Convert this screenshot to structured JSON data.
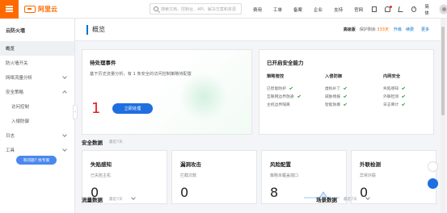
{
  "topbar": {
    "logo_text": "阿里云",
    "search_placeholder": "搜索文档、控制台、API、解决方案和资源",
    "nav": [
      "费用",
      "工单",
      "备案",
      "企业",
      "支持",
      "官网"
    ],
    "lang": "简体"
  },
  "sidebar": {
    "title": "云防火墙",
    "items": [
      {
        "label": "概览",
        "active": true,
        "chevron": false,
        "sub": false
      },
      {
        "label": "防火墙开关",
        "active": false,
        "chevron": false,
        "sub": false
      },
      {
        "label": "网络流量分析",
        "active": false,
        "chevron": true,
        "sub": false
      },
      {
        "label": "安全策略",
        "active": false,
        "chevron": true,
        "sub": false
      },
      {
        "label": "访问控制",
        "active": false,
        "chevron": false,
        "sub": true
      },
      {
        "label": "入侵防御",
        "active": false,
        "chevron": false,
        "sub": true
      },
      {
        "label": "日志",
        "active": false,
        "chevron": true,
        "sub": false
      },
      {
        "label": "工具",
        "active": false,
        "chevron": true,
        "sub": false
      }
    ],
    "help_label": "有问题? 找专家",
    "collapse_glyph": "‹"
  },
  "header": {
    "title": "概览",
    "edition": "高级版",
    "protect_label": "保护剩余",
    "protect_value": "333天",
    "upgrade": "升级",
    "renew": "续费",
    "more": "更多"
  },
  "pending": {
    "title": "待处理事件",
    "desc": "基于历史流量分析，有 1 条安全的访问控制策略待配置",
    "count": "1",
    "button": "立即处理"
  },
  "enabled": {
    "title": "已开启安全能力",
    "columns": [
      {
        "head": "策略管控",
        "items": [
          "已智能防护",
          "互联网边界放通",
          "主机边界隔离"
        ],
        "checked": [
          true,
          true,
          false
        ]
      },
      {
        "head": "入侵防御",
        "items": [
          "虚拟补丁",
          "威胁情报",
          "智能防御"
        ],
        "checked": [
          true,
          true,
          true
        ]
      },
      {
        "head": "内网安全",
        "items": [
          "失陷感知",
          "外联检测",
          "日志审计"
        ],
        "checked": [
          true,
          true,
          true
        ]
      }
    ]
  },
  "security": {
    "title": "安全数据",
    "sub": "最近7天",
    "cards": [
      {
        "title": "失陷感知",
        "sub": "已失陷主机",
        "value": "0"
      },
      {
        "title": "漏洞攻击",
        "sub": "拦截次数",
        "value": "0"
      },
      {
        "title": "风险配置",
        "sub": "策略未覆盖端口",
        "value": "8"
      },
      {
        "title": "外联检测",
        "sub": "异常外联",
        "value": "0"
      }
    ]
  },
  "traffic": {
    "title": "流量数据",
    "sub": "最近7天"
  },
  "scene": {
    "title": "场景数据",
    "sub": "最近7天"
  },
  "colors": {
    "brand": "#ff6a00",
    "primary": "#1f6fe0",
    "danger": "#e02020",
    "success": "#2ba245"
  }
}
